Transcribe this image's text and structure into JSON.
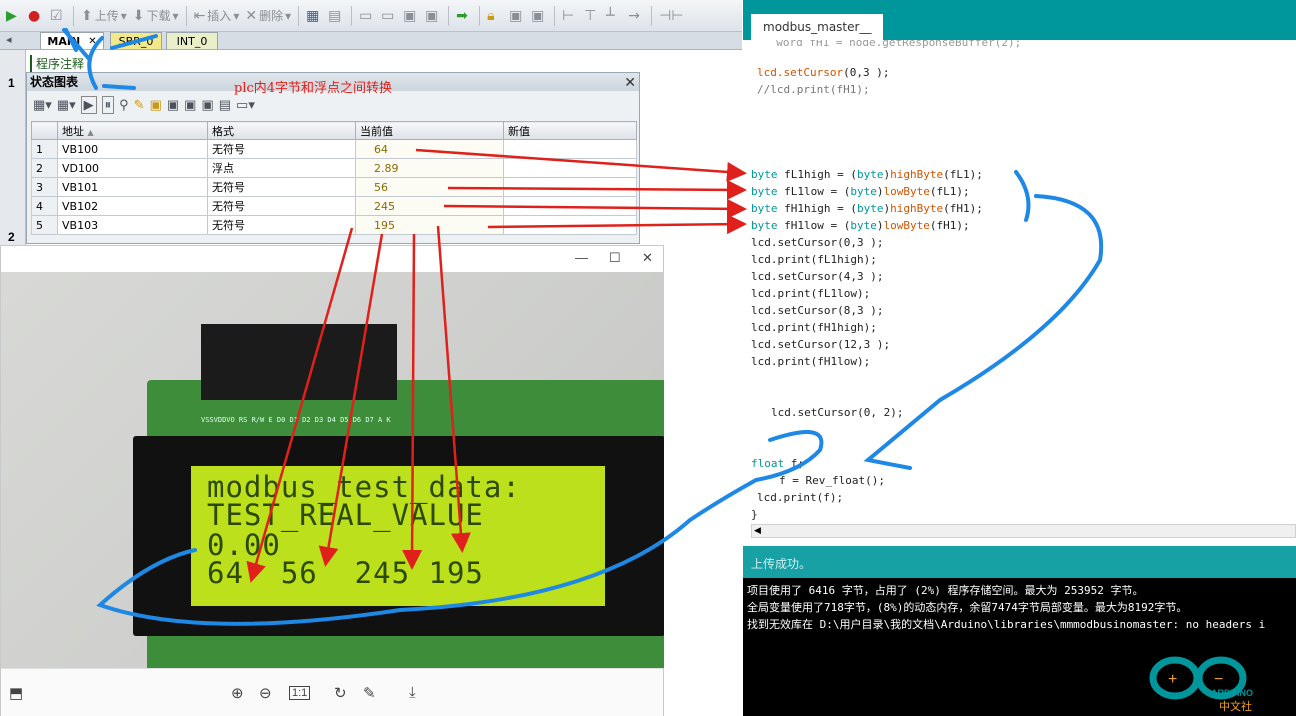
{
  "plc": {
    "toolbar": {
      "upload": "上传",
      "download": "下载",
      "insert": "插入",
      "delete": "删除"
    },
    "tabs": [
      "MAIN",
      "SBR_0",
      "INT_0"
    ],
    "row_numbers": [
      "1",
      "2"
    ],
    "program_note": "程序注释",
    "status_chart": {
      "title": "状态图表",
      "headers": [
        "地址",
        "格式",
        "当前值",
        "新值"
      ],
      "rows": [
        {
          "idx": "1",
          "address": "VB100",
          "format": "无符号",
          "value": "64"
        },
        {
          "idx": "2",
          "address": "VD100",
          "format": "浮点",
          "value": "2.89"
        },
        {
          "idx": "3",
          "address": "VB101",
          "format": "无符号",
          "value": "56"
        },
        {
          "idx": "4",
          "address": "VB102",
          "format": "无符号",
          "value": "245"
        },
        {
          "idx": "5",
          "address": "VB103",
          "format": "无符号",
          "value": "195"
        }
      ]
    },
    "annotation": "plc内4字节和浮点之间转换"
  },
  "lcd": {
    "lines": [
      "modbus_test_data:",
      "TEST_REAL_VALUE",
      "0.00",
      "64  56  245 195"
    ],
    "pins_label": "VSSVDDVO RS R/W E D0 D1 D2 D3 D4 D5 D6 D7 A K"
  },
  "arduino": {
    "tab": "modbus_master__",
    "code": [
      "lcd.setCursor(0,3 );",
      "//lcd.print(fH1);",
      "byte fL1high = (byte)highByte(fL1);",
      "byte fL1low = (byte)lowByte(fL1);",
      "byte fH1high = (byte)highByte(fH1);",
      "byte fH1low = (byte)lowByte(fH1);",
      "lcd.setCursor(0,3 );",
      "lcd.print(fL1high);",
      "lcd.setCursor(4,3 );",
      "lcd.print(fL1low);",
      "lcd.setCursor(8,3 );",
      "lcd.print(fH1high);",
      "lcd.setCursor(12,3 );",
      "lcd.print(fH1low);",
      "lcd.setCursor(0, 2);",
      "float f;",
      "f = Rev_float();",
      "lcd.print(f);",
      "}"
    ],
    "status": "上传成功。",
    "console": [
      "项目使用了 6416 字节，占用了 (2%) 程序存储空间。最大为 253952 字节。",
      "全局变量使用了718字节，(8%)的动态内存，余留7474字节局部变量。最大为8192字节。",
      "找到无效库在 D:\\用户目录\\我的文档\\Arduino\\libraries\\mmmodbusinomaster: no headers i"
    ],
    "logo_text": "ARDUINO",
    "logo_sub": "中文社区"
  },
  "colors": {
    "arduino_teal": "#00979c",
    "annotation_red": "#e0201a",
    "annotation_blue": "#1e88e5",
    "lcd_green": "#bde01d"
  }
}
